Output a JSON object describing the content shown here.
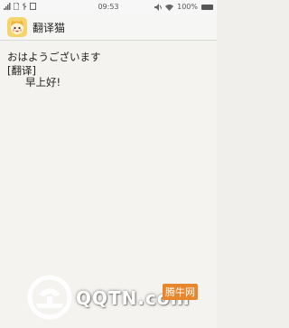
{
  "status_bar": {
    "time": "09:53",
    "battery": "100%",
    "left_icons": [
      "signal-icon",
      "sim-icon",
      "usb-icon",
      "notification-icon"
    ],
    "right_icons": [
      "mute-icon",
      "wifi-icon",
      "battery-icon"
    ]
  },
  "app_bar": {
    "title": "翻译猫",
    "icon": "cat-app-icon"
  },
  "translation": {
    "source_text": "おはようございます",
    "result_tag": "[翻译]",
    "result_text": "早上好!"
  },
  "watermark": {
    "text": "QQTN.com",
    "brand": "腾牛网",
    "colors": {
      "emblem": "#ffffff",
      "brand_bg": "#e8862c"
    }
  }
}
